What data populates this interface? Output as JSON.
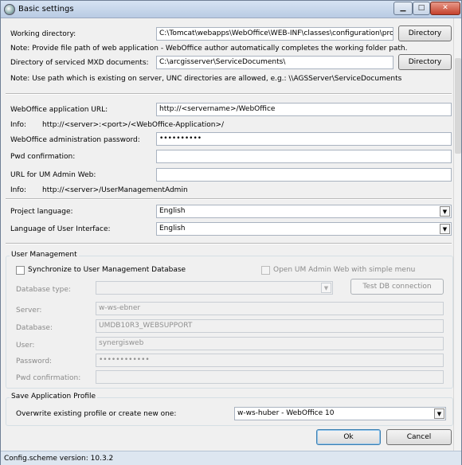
{
  "window": {
    "title": "Basic settings"
  },
  "caption": {
    "minimize": "▁",
    "maximize": "□",
    "close": "✕"
  },
  "working_dir": {
    "label": "Working directory:",
    "value": "C:\\Tomcat\\webapps\\WebOffice\\WEB-INF\\classes\\configuration\\projects\\",
    "button": "Directory",
    "note": "Note: Provide file path of web application - WebOffice author automatically completes the working folder path."
  },
  "mxd_dir": {
    "label": "Directory of serviced MXD documents:",
    "value": "C:\\arcgisserver\\ServiceDocuments\\",
    "button": "Directory",
    "note": "Note: Use path which is existing on server, UNC directories are allowed, e.g.: \\\\AGSServer\\ServiceDocuments"
  },
  "app_url": {
    "label": "WebOffice application URL:",
    "value": "http://<servername>/WebOffice",
    "info_label": "Info:",
    "info_value": "http://<server>:<port>/<WebOffice-Application>/"
  },
  "admin_pwd": {
    "label": "WebOffice administration password:",
    "value": "••••••••••"
  },
  "pwd_confirm": {
    "label": "Pwd confirmation:",
    "value": ""
  },
  "um_url": {
    "label": "URL for UM Admin Web:",
    "value": "",
    "info_label": "Info:",
    "info_value": "http://<server>/UserManagementAdmin"
  },
  "project_lang": {
    "label": "Project language:",
    "value": "English"
  },
  "ui_lang": {
    "label": "Language of User Interface:",
    "value": "English"
  },
  "user_mgmt": {
    "title": "User Management",
    "sync_label": "Synchronize to User Management Database",
    "open_label": "Open UM Admin Web with simple menu",
    "db_type_label": "Database type:",
    "db_type_value": "",
    "test_button": "Test DB connection",
    "server_label": "Server:",
    "server_value": "w-ws-ebner",
    "database_label": "Database:",
    "database_value": "UMDB10R3_WEBSUPPORT",
    "user_label": "User:",
    "user_value": "synergisweb",
    "password_label": "Password:",
    "password_value": "••••••••••••",
    "pwd_confirm_label": "Pwd confirmation:",
    "pwd_confirm_value": ""
  },
  "profile": {
    "title": "Save Application Profile",
    "label": "Overwrite existing profile or create new one:",
    "value": "w-ws-huber - WebOffice 10"
  },
  "buttons": {
    "ok": "Ok",
    "cancel": "Cancel"
  },
  "status": {
    "text": "Config.scheme version: 10.3.2"
  }
}
